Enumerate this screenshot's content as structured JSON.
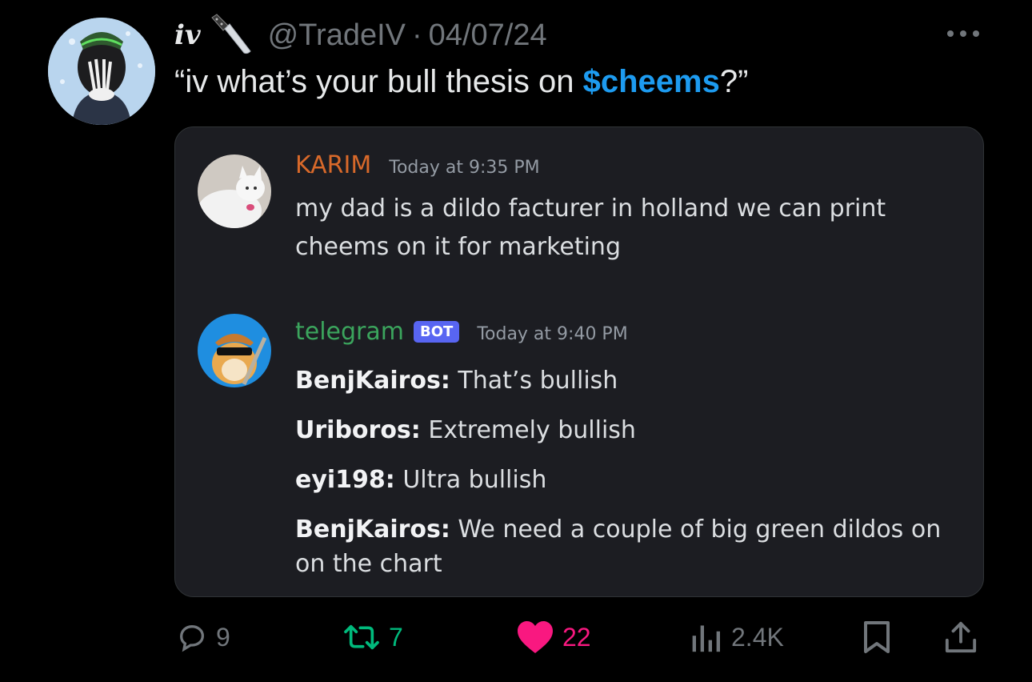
{
  "tweet": {
    "display_name": "iv",
    "handle": "@TradeIV",
    "separator": "·",
    "date": "04/07/24",
    "text_before": "“iv what’s your bull thesis on ",
    "cashtag": "$cheems",
    "text_after": "?”"
  },
  "embedded_chat": {
    "message1": {
      "author": "KARIM",
      "timestamp": "Today at 9:35 PM",
      "line1": "my dad is a dildo facturer in holland we can print",
      "line2": "cheems on it for marketing"
    },
    "message2": {
      "author": "telegram",
      "badge": "BOT",
      "timestamp": "Today at 9:40 PM",
      "lines": [
        {
          "user": "BenjKairos:",
          "text": " That’s bullish"
        },
        {
          "user": "Uriboros:",
          "text": " Extremely bullish"
        },
        {
          "user": "eyi198:",
          "text": " Ultra bullish"
        },
        {
          "user": "BenjKairos:",
          "text": " We need a couple of big green dildos on"
        }
      ],
      "continuation": "on the chart"
    }
  },
  "actions": {
    "replies": "9",
    "reposts": "7",
    "likes": "22",
    "views": "2.4K"
  },
  "colors": {
    "background": "#000000",
    "cashtag": "#1d9bf0",
    "repost": "#00ba7c",
    "like": "#f91880",
    "muted": "#71767b",
    "chat_bg": "#1c1d22",
    "bot_badge": "#5865f2"
  },
  "icons": [
    "knife-icon",
    "more-icon",
    "reply-icon",
    "repost-icon",
    "like-icon",
    "views-icon",
    "bookmark-icon",
    "share-icon"
  ]
}
